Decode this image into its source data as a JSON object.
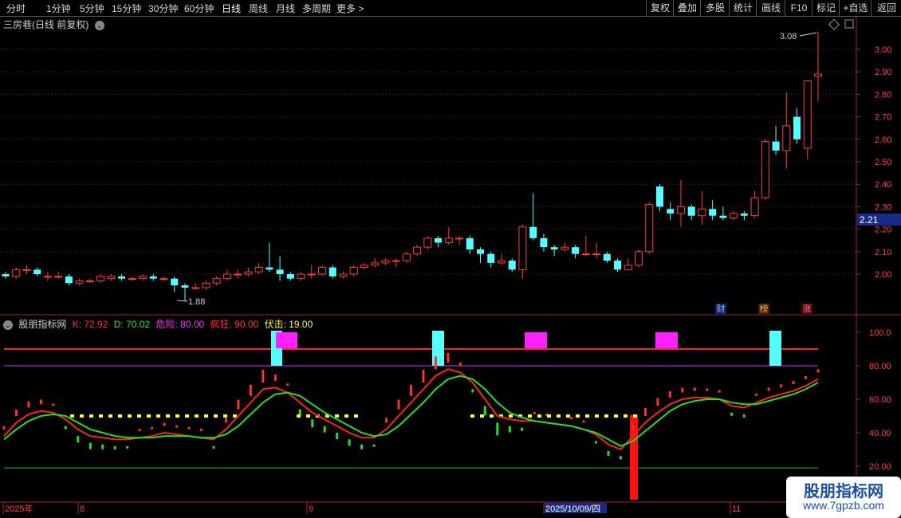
{
  "toolbar": {
    "periods": [
      "分时",
      "1分钟",
      "5分钟",
      "15分钟",
      "30分钟",
      "60分钟",
      "日线",
      "周线",
      "月线",
      "多周期",
      "更多 >"
    ],
    "active_period": "日线",
    "actions": [
      "复权",
      "叠加",
      "多股",
      "统计",
      "画线",
      "F10",
      "标记",
      "+自选",
      "返回"
    ]
  },
  "stock": {
    "name_line": "三房巷(日线 前复权)",
    "high_marker": "3.08",
    "low_marker": "1.88",
    "current_price": "2.21"
  },
  "price_axis": [
    "3.00",
    "2.90",
    "2.80",
    "2.70",
    "2.60",
    "2.50",
    "2.40",
    "2.30",
    "2.20",
    "2.10",
    "2.00"
  ],
  "badges": [
    "财",
    "榜",
    "涨"
  ],
  "indicator": {
    "name": "股朋指标网",
    "k": "K: 72.92",
    "d": "D: 70.02",
    "danger": "危险: 80.00",
    "crazy": "疯狂: 90.00",
    "ambush": "伏击: 19.00",
    "axis": [
      "100.0",
      "80.00",
      "60.00",
      "40.00",
      "20.00"
    ]
  },
  "date_axis": {
    "labels": [
      "2025年",
      "8",
      "9",
      "2025/10/09/四",
      "11"
    ]
  },
  "watermark": {
    "name": "股朋指标网",
    "url": "www.7gpzb.com"
  },
  "colors": {
    "up": "#ff3c3c",
    "down": "#54ffff",
    "k_line": "#ff2020",
    "d_line": "#20e020",
    "magenta": "#ff20ff",
    "yellow": "#ffff20"
  },
  "chart_data": {
    "type": "candlestick",
    "ylim": [
      1.85,
      3.1
    ],
    "candles": [
      [
        2.0,
        1.99,
        2.01,
        1.98
      ],
      [
        1.99,
        2.02,
        2.03,
        1.98
      ],
      [
        2.02,
        2.02,
        2.04,
        2.0
      ],
      [
        2.02,
        2.0,
        2.03,
        1.99
      ],
      [
        1.99,
        1.99,
        2.01,
        1.97
      ],
      [
        1.99,
        1.99,
        2.01,
        1.98
      ],
      [
        1.99,
        1.96,
        2.0,
        1.95
      ],
      [
        1.96,
        1.97,
        1.98,
        1.95
      ],
      [
        1.97,
        1.97,
        1.98,
        1.96
      ],
      [
        1.97,
        1.99,
        2.0,
        1.96
      ],
      [
        1.98,
        1.99,
        2.0,
        1.97
      ],
      [
        1.99,
        1.98,
        2.0,
        1.97
      ],
      [
        1.98,
        1.98,
        1.99,
        1.97
      ],
      [
        1.98,
        1.99,
        2.0,
        1.97
      ],
      [
        1.99,
        1.98,
        2.0,
        1.97
      ],
      [
        1.98,
        1.98,
        1.99,
        1.97
      ],
      [
        1.98,
        1.95,
        1.99,
        1.92
      ],
      [
        1.95,
        1.94,
        1.96,
        1.88
      ],
      [
        1.94,
        1.94,
        1.96,
        1.93
      ],
      [
        1.94,
        1.96,
        1.97,
        1.93
      ],
      [
        1.96,
        1.98,
        1.99,
        1.95
      ],
      [
        1.98,
        2.0,
        2.02,
        1.97
      ],
      [
        2.0,
        2.0,
        2.02,
        1.98
      ],
      [
        2.0,
        2.01,
        2.03,
        1.99
      ],
      [
        2.01,
        2.03,
        2.05,
        2.0
      ],
      [
        2.03,
        2.02,
        2.14,
        2.01
      ],
      [
        2.02,
        2.0,
        2.08,
        1.97
      ],
      [
        2.0,
        1.98,
        2.01,
        1.97
      ],
      [
        1.98,
        2.0,
        2.01,
        1.97
      ],
      [
        2.0,
        2.0,
        2.04,
        1.98
      ],
      [
        2.0,
        2.03,
        2.04,
        1.99
      ],
      [
        2.03,
        1.99,
        2.04,
        1.98
      ],
      [
        1.99,
        2.0,
        2.01,
        1.98
      ],
      [
        2.0,
        2.03,
        2.04,
        1.99
      ],
      [
        2.03,
        2.04,
        2.05,
        2.02
      ],
      [
        2.04,
        2.05,
        2.07,
        2.03
      ],
      [
        2.05,
        2.06,
        2.07,
        2.04
      ],
      [
        2.06,
        2.06,
        2.07,
        2.03
      ],
      [
        2.06,
        2.09,
        2.1,
        2.05
      ],
      [
        2.09,
        2.12,
        2.13,
        2.08
      ],
      [
        2.12,
        2.16,
        2.17,
        2.11
      ],
      [
        2.16,
        2.14,
        2.17,
        2.12
      ],
      [
        2.14,
        2.16,
        2.21,
        2.13
      ],
      [
        2.16,
        2.16,
        2.17,
        2.13
      ],
      [
        2.16,
        2.11,
        2.17,
        2.09
      ],
      [
        2.11,
        2.09,
        2.12,
        2.05
      ],
      [
        2.09,
        2.05,
        2.1,
        2.03
      ],
      [
        2.05,
        2.06,
        2.09,
        2.04
      ],
      [
        2.06,
        2.02,
        2.07,
        2.01
      ],
      [
        2.02,
        2.21,
        2.22,
        1.98
      ],
      [
        2.21,
        2.16,
        2.36,
        2.15
      ],
      [
        2.16,
        2.12,
        2.18,
        2.1
      ],
      [
        2.12,
        2.11,
        2.13,
        2.08
      ],
      [
        2.11,
        2.12,
        2.14,
        2.1
      ],
      [
        2.12,
        2.09,
        2.13,
        2.07
      ],
      [
        2.09,
        2.09,
        2.17,
        2.08
      ],
      [
        2.09,
        2.09,
        2.14,
        2.07
      ],
      [
        2.09,
        2.06,
        2.1,
        2.05
      ],
      [
        2.06,
        2.02,
        2.07,
        2.01
      ],
      [
        2.02,
        2.04,
        2.07,
        2.02
      ],
      [
        2.04,
        2.1,
        2.11,
        2.03
      ],
      [
        2.1,
        2.31,
        2.32,
        2.09
      ],
      [
        2.39,
        2.3,
        2.4,
        2.28
      ],
      [
        2.29,
        2.27,
        2.32,
        2.24
      ],
      [
        2.27,
        2.3,
        2.42,
        2.21
      ],
      [
        2.3,
        2.26,
        2.31,
        2.24
      ],
      [
        2.26,
        2.29,
        2.37,
        2.22
      ],
      [
        2.29,
        2.26,
        2.33,
        2.24
      ],
      [
        2.26,
        2.25,
        2.3,
        2.24
      ],
      [
        2.25,
        2.27,
        2.28,
        2.24
      ],
      [
        2.27,
        2.26,
        2.28,
        2.24
      ],
      [
        2.26,
        2.34,
        2.37,
        2.25
      ],
      [
        2.34,
        2.59,
        2.6,
        2.33
      ],
      [
        2.59,
        2.55,
        2.66,
        2.53
      ],
      [
        2.55,
        2.66,
        2.81,
        2.47
      ],
      [
        2.7,
        2.6,
        2.74,
        2.58
      ],
      [
        2.56,
        2.86,
        2.86,
        2.51
      ],
      [
        2.88,
        2.89,
        3.08,
        2.77
      ]
    ],
    "k_values": [
      38,
      46,
      51,
      53,
      52,
      48,
      42,
      38,
      37,
      36,
      36,
      37,
      38,
      40,
      39,
      38,
      37,
      36,
      42,
      50,
      58,
      66,
      67,
      64,
      58,
      52,
      48,
      44,
      40,
      37,
      37,
      42,
      50,
      58,
      66,
      74,
      78,
      76,
      70,
      60,
      50,
      48,
      47,
      47,
      46,
      45,
      44,
      42,
      39,
      33,
      30,
      38,
      46,
      52,
      57,
      60,
      61,
      61,
      60,
      56,
      55,
      58,
      61,
      63,
      65,
      68,
      72
    ],
    "d_values": [
      36,
      42,
      47,
      50,
      51,
      50,
      46,
      42,
      40,
      38,
      37,
      37,
      37,
      38,
      38,
      38,
      37,
      37,
      39,
      44,
      51,
      58,
      63,
      64,
      62,
      57,
      52,
      48,
      44,
      40,
      38,
      39,
      44,
      51,
      58,
      66,
      72,
      74,
      72,
      66,
      58,
      52,
      49,
      47,
      46,
      45,
      44,
      42,
      40,
      36,
      32,
      35,
      41,
      47,
      53,
      57,
      59,
      60,
      60,
      58,
      57,
      57,
      59,
      61,
      63,
      66,
      70
    ],
    "markers": {
      "danger_level": 80,
      "crazy_level": 90,
      "ambush_level": 19
    }
  }
}
